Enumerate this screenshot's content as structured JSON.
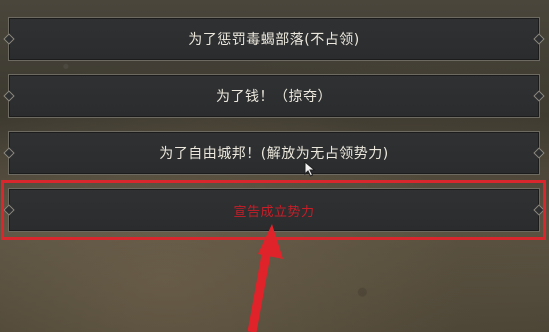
{
  "dialogue": {
    "choices": [
      {
        "label": "为了惩罚毒蝎部落(不占领)"
      },
      {
        "label": "为了钱！（掠夺）"
      },
      {
        "label": "为了自由城邦！(解放为无占领势力)"
      },
      {
        "label": "宣告成立势力"
      }
    ]
  },
  "annotation": {
    "highlight_color": "#d8282e",
    "arrow_color": "#e0232b",
    "highlighted_choice_index": 3
  },
  "icons": {
    "choice_ornament": "diamond-ornament-icon",
    "cursor": "mouse-pointer-icon",
    "annotation_arrow": "red-arrow-icon"
  }
}
